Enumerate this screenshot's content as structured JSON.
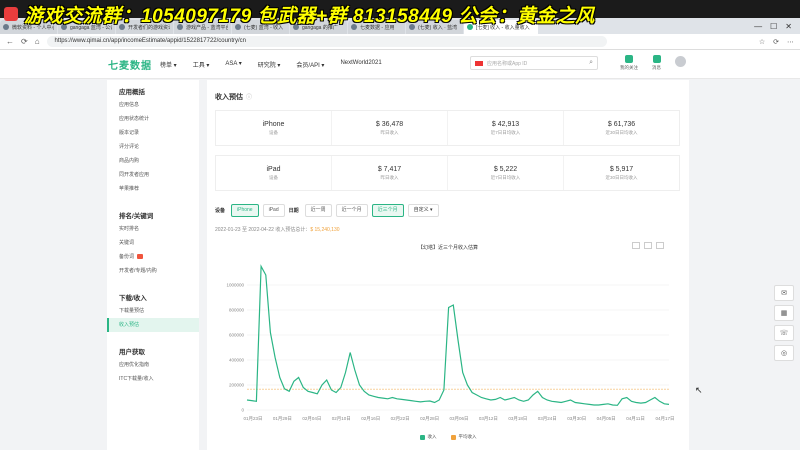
{
  "overlay": {
    "text": "游戏交流群：1054097179 包武器+群 813158449 公会：黄金之风"
  },
  "browser": {
    "tabs": [
      "微软资料 - 个人中心",
      "gangaga 蓝湾 - 公会",
      "开发者们的游戏资讯",
      "游戏产品 - 蓝湾平台",
      "(七麦) 蓝湾 - 收入",
      "gangaga 的推广",
      "七麦数据 - 应用",
      "(七麦) 收入 · 蓝湾"
    ],
    "active_tab": "[七麦] 收入 - 收入量收入",
    "url": "https://www.qimai.cn/app/incomeEstimate/appid/1522817722/country/cn",
    "win_controls": [
      "—",
      "☐",
      "✕"
    ],
    "right_icons": [
      "☆",
      "⟳",
      "⋯"
    ]
  },
  "topnav": {
    "logo": "七麦数据",
    "items": [
      "榜单 ▾",
      "工具 ▾",
      "ASA ▾",
      "研究院 ▾",
      "会员/API ▾",
      "NextWorld2021"
    ],
    "search_placeholder": "应用名称或App ID",
    "right": [
      "我的关注",
      "消息"
    ]
  },
  "sidebar": {
    "groups": [
      {
        "title": "应用概括",
        "items": [
          "应用信息",
          "应用状态统计",
          "版本记录",
          "评分评论",
          "商品内购",
          "同开发者应用",
          "苹果推荐"
        ]
      },
      {
        "title": "排名/关键词",
        "items": [
          "实时排名",
          "关键词",
          "备份词",
          "开发者/专题/内购"
        ]
      },
      {
        "title": "下载/收入",
        "items": [
          "下载量预估",
          "收入预估"
        ]
      },
      {
        "title": "用户获取",
        "items": [
          "应用优化指南",
          "ITC下载量/收入"
        ]
      }
    ],
    "active": "收入预估",
    "badge_item": "备份词"
  },
  "main": {
    "title": "收入预估",
    "iphone": {
      "name": "iPhone",
      "name_sub": "设备",
      "values": [
        {
          "v": "$ 36,478",
          "l": "昨日收入"
        },
        {
          "v": "$ 42,913",
          "l": "近7日日均收入"
        },
        {
          "v": "$ 61,736",
          "l": "近30日日均收入"
        }
      ]
    },
    "ipad": {
      "name": "iPad",
      "name_sub": "设备",
      "values": [
        {
          "v": "$ 7,417",
          "l": "昨日收入"
        },
        {
          "v": "$ 5,222",
          "l": "近7日日均收入"
        },
        {
          "v": "$ 5,917",
          "l": "近30日日均收入"
        }
      ]
    },
    "filters": {
      "device_label": "设备",
      "device": [
        "iPhone",
        "iPad"
      ],
      "date_label": "日期",
      "range": [
        "近一周",
        "近一个月",
        "近三个月"
      ],
      "custom": "自定义 ▾"
    },
    "summary_text": "2022-01-23 至 2022-04-22 收入预估总计：",
    "summary_amount": "$ 15,240,130"
  },
  "chart_data": {
    "type": "line",
    "title": "【幻塔】近三个月收入估算",
    "xlabel": "",
    "ylabel": "",
    "ylim": [
      0,
      1200000
    ],
    "yticks": [
      "0",
      "200000",
      "400000",
      "600000",
      "800000",
      "1000000"
    ],
    "xticks": [
      "01月23日",
      "01月29日",
      "02月04日",
      "02月10日",
      "02月16日",
      "02月22日",
      "02月28日",
      "03月06日",
      "03月12日",
      "03月18日",
      "03月24日",
      "03月30日",
      "04月05日",
      "04月11日",
      "04月17日"
    ],
    "series": [
      {
        "name": "收入",
        "color": "#2bb585",
        "values": [
          80000,
          75000,
          70000,
          1150000,
          1080000,
          620000,
          420000,
          260000,
          170000,
          150000,
          230000,
          260000,
          180000,
          150000,
          140000,
          130000,
          200000,
          240000,
          160000,
          140000,
          180000,
          300000,
          460000,
          320000,
          200000,
          150000,
          120000,
          110000,
          100000,
          95000,
          90000,
          100000,
          90000,
          85000,
          80000,
          75000,
          70000,
          65000,
          70000,
          72000,
          60000,
          80000,
          160000,
          820000,
          840000,
          560000,
          300000,
          200000,
          140000,
          120000,
          100000,
          90000,
          80000,
          85000,
          100000,
          80000,
          90000,
          100000,
          80000,
          70000,
          80000,
          120000,
          150000,
          100000,
          80000,
          70000,
          65000,
          60000,
          70000,
          80000,
          60000,
          55000,
          50000,
          45000,
          40000,
          40000,
          45000,
          50000,
          40000,
          38000,
          90000,
          100000,
          70000,
          60000,
          55000,
          60000,
          80000,
          100000,
          70000,
          50000,
          45000
        ]
      },
      {
        "name": "平均收入",
        "color": "#f0a23c",
        "values": [
          167000
        ]
      }
    ]
  },
  "floatbar": [
    "客服",
    "反馈",
    "咨询",
    "微信"
  ]
}
